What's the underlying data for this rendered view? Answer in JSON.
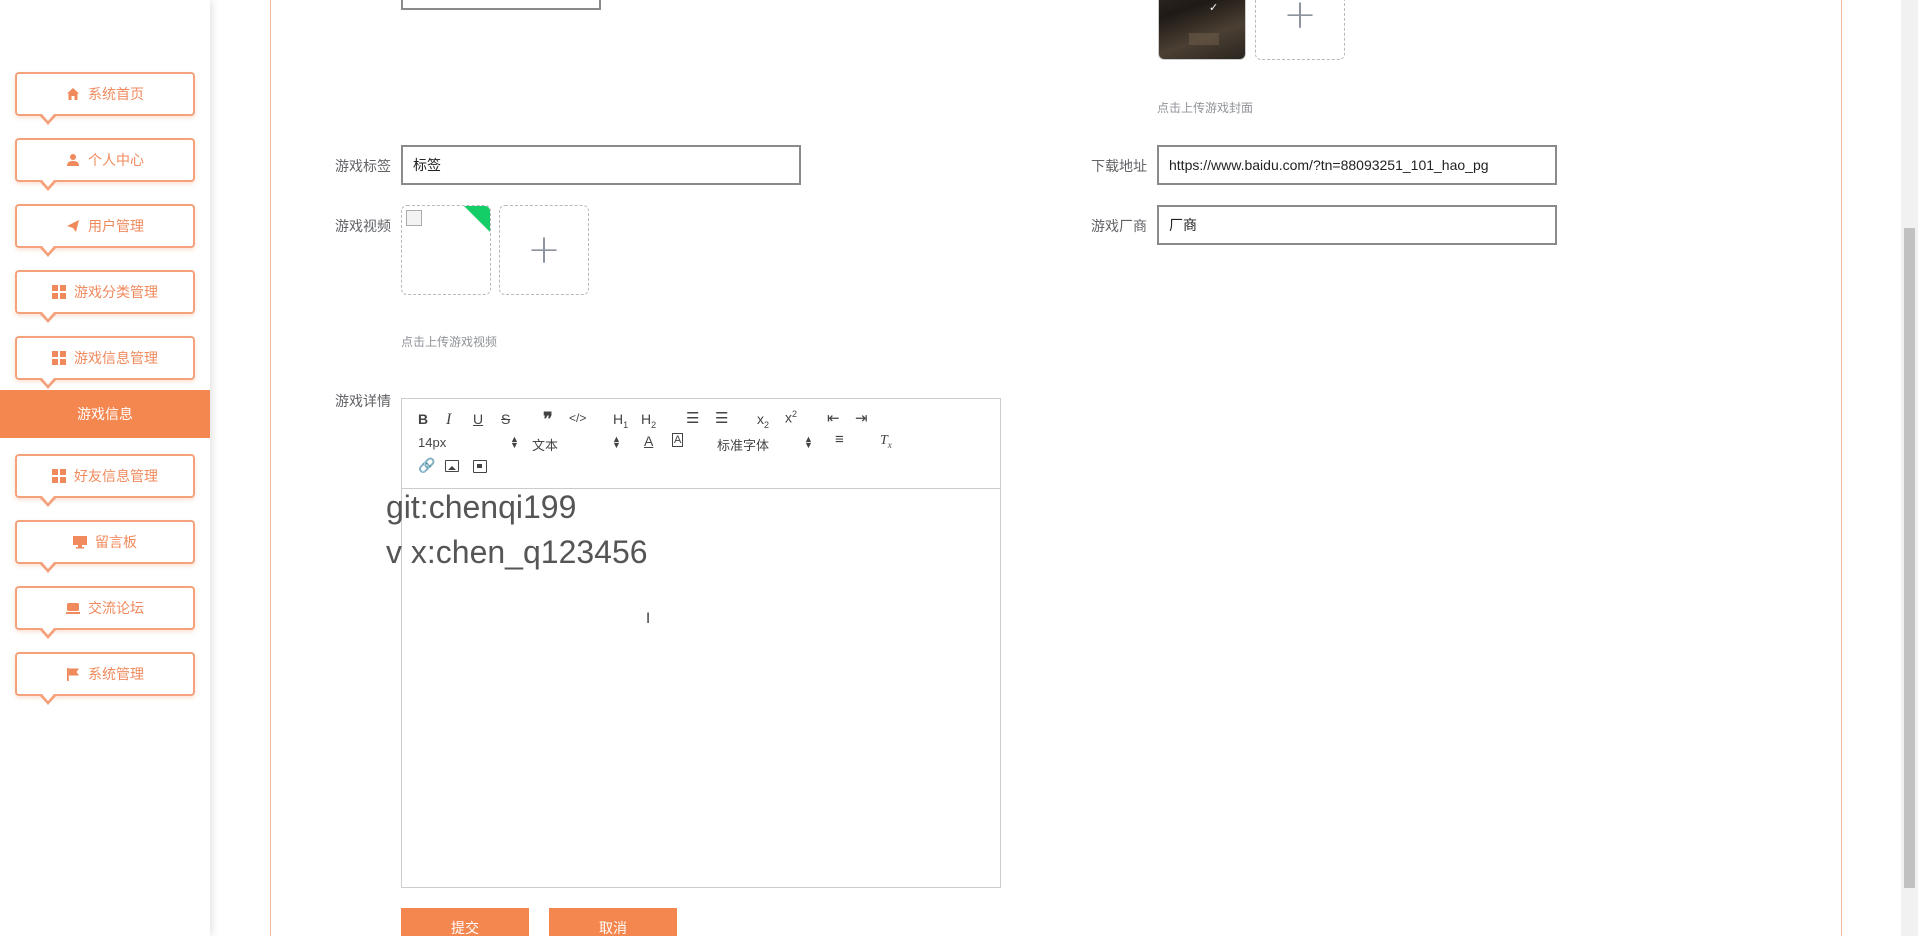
{
  "sidebar": {
    "items": [
      {
        "label": "系统首页",
        "icon": "home-icon"
      },
      {
        "label": "个人中心",
        "icon": "user-icon"
      },
      {
        "label": "用户管理",
        "icon": "send-icon"
      },
      {
        "label": "游戏分类管理",
        "icon": "grid-icon"
      },
      {
        "label": "游戏信息管理",
        "icon": "grid-icon"
      },
      {
        "label": "好友信息管理",
        "icon": "grid-icon"
      },
      {
        "label": "留言板",
        "icon": "monitor-icon"
      },
      {
        "label": "交流论坛",
        "icon": "chat-icon"
      },
      {
        "label": "系统管理",
        "icon": "flag-icon"
      }
    ],
    "active_sub": "游戏信息"
  },
  "form": {
    "cover_hint": "点击上传游戏封面",
    "tag_label": "游戏标签",
    "tag_value": "标签",
    "download_label": "下载地址",
    "download_value": "https://www.baidu.com/?tn=88093251_101_hao_pg",
    "video_label": "游戏视频",
    "video_hint": "点击上传游戏视频",
    "vendor_label": "游戏厂商",
    "vendor_value": "厂商",
    "detail_label": "游戏详情"
  },
  "editor": {
    "font_size": "14px",
    "header": "文本",
    "font": "标准字体",
    "content_lines": [
      "git:chenqi199",
      "v x:chen_q123456"
    ]
  },
  "buttons": {
    "submit": "提交",
    "cancel": "取消"
  },
  "colors": {
    "accent": "#f4874f",
    "border_accent": "#f4a27b"
  }
}
